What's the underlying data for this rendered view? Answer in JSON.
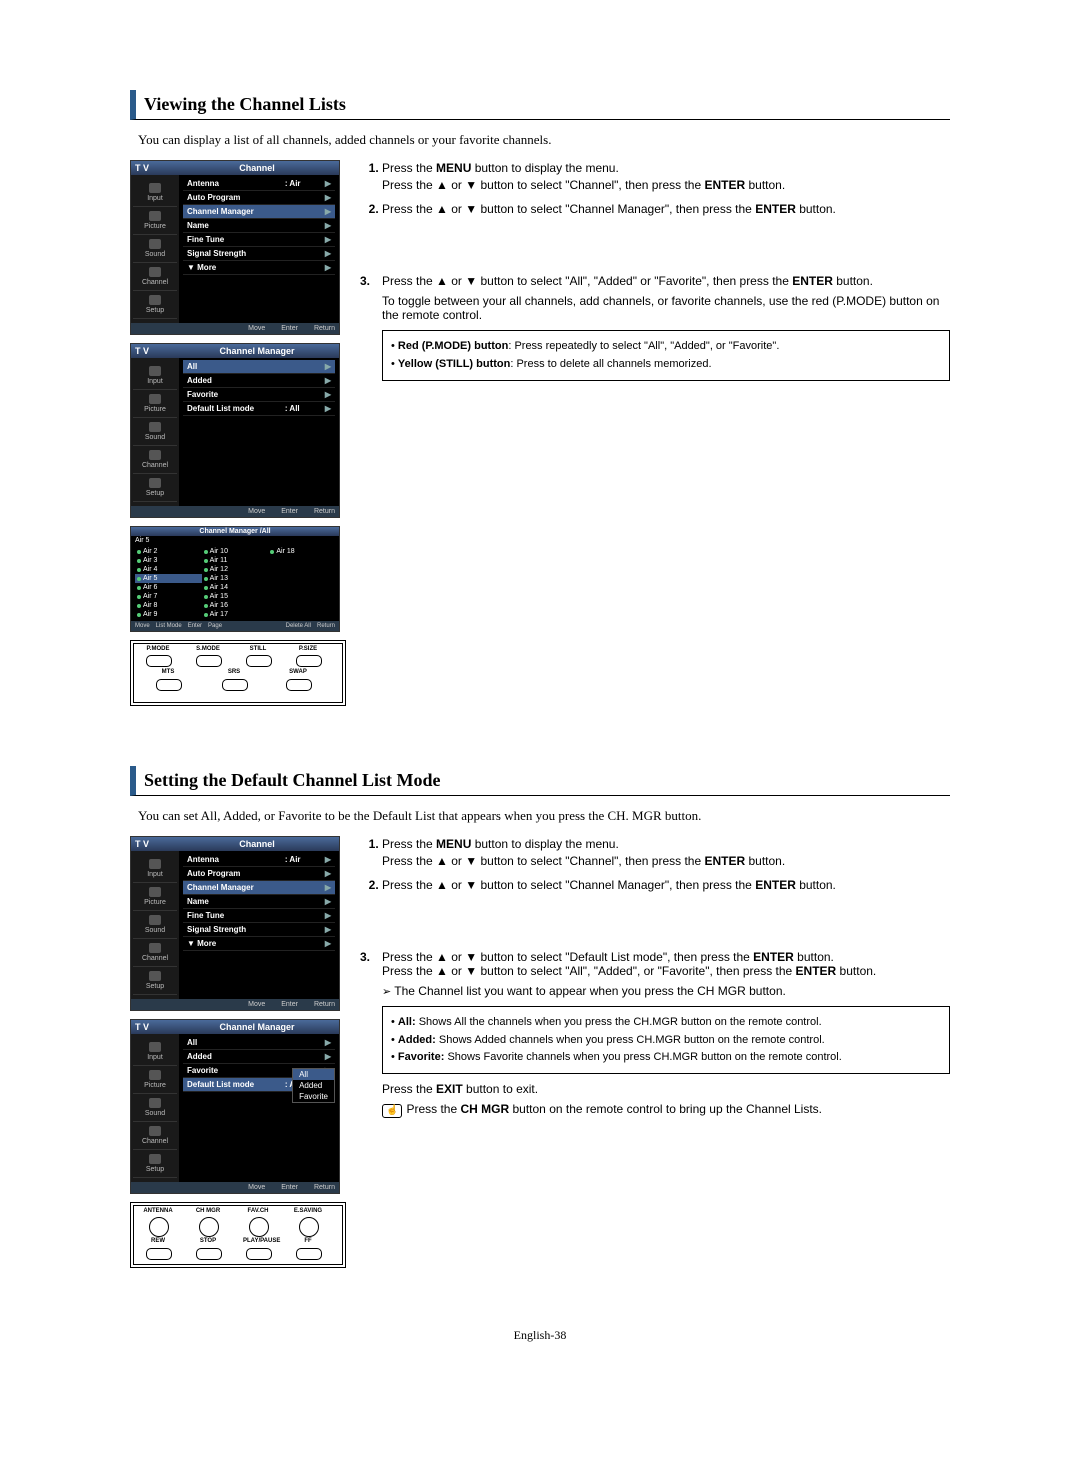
{
  "page_number": "English-38",
  "section1": {
    "heading": "Viewing the Channel Lists",
    "intro": "You can display a list of all channels, added channels or your favorite channels.",
    "osd1": {
      "tv": "T V",
      "title": "Channel",
      "sidebar": [
        "Input",
        "Picture",
        "Sound",
        "Channel",
        "Setup"
      ],
      "rows": [
        {
          "label": "Antenna",
          "value": ": Air",
          "hl": false
        },
        {
          "label": "Auto Program",
          "value": "",
          "hl": false
        },
        {
          "label": "Channel Manager",
          "value": "",
          "hl": true
        },
        {
          "label": "Name",
          "value": "",
          "hl": false
        },
        {
          "label": "Fine Tune",
          "value": "",
          "hl": false
        },
        {
          "label": "Signal Strength",
          "value": "",
          "hl": false
        },
        {
          "label": "▼ More",
          "value": "",
          "hl": false
        }
      ],
      "footer": [
        "Move",
        "Enter",
        "Return"
      ]
    },
    "osd2": {
      "tv": "T V",
      "title": "Channel Manager",
      "sidebar": [
        "Input",
        "Picture",
        "Sound",
        "Channel",
        "Setup"
      ],
      "rows": [
        {
          "label": "All",
          "value": "",
          "hl": true
        },
        {
          "label": "Added",
          "value": "",
          "hl": false
        },
        {
          "label": "Favorite",
          "value": "",
          "hl": false
        },
        {
          "label": "Default List mode",
          "value": ": All",
          "hl": false
        }
      ],
      "footer": [
        "Move",
        "Enter",
        "Return"
      ]
    },
    "chlist": {
      "title": "Channel Manager /All",
      "header": "Air 5",
      "col1": [
        "Air 2",
        "Air 3",
        "Air 4",
        "Air 5",
        "Air 6",
        "Air 7",
        "Air 8",
        "Air 9"
      ],
      "col2": [
        "Air 10",
        "Air 11",
        "Air 12",
        "Air 13",
        "Air 14",
        "Air 15",
        "Air 16",
        "Air 17"
      ],
      "col3": [
        "Air 18"
      ],
      "footer": [
        "Move",
        "List Mode",
        "Enter",
        "Page",
        "Delete All",
        "Return"
      ]
    },
    "remote": {
      "row1": [
        "P.MODE",
        "S.MODE",
        "STILL",
        "P.SIZE"
      ],
      "row2": [
        "MTS",
        "SRS",
        "SWAP"
      ]
    },
    "steps_a": [
      "Press the <b>MENU</b> button to display the menu.<br>Press the <span class='up'>▲</span> or <span class='up'>▼</span> button to select \"Channel\", then press the <b>ENTER</b> button.",
      "Press the <span class='up'>▲</span> or <span class='up'>▼</span> button to select \"Channel Manager\", then press the <b>ENTER</b> button."
    ],
    "steps_b_num": "3.",
    "steps_b_text": "Press the <span class='up'>▲</span> or <span class='up'>▼</span> button to select \"All\", \"Added\" or \"Favorite\", then press the <b>ENTER</b> button.",
    "steps_b_sub": "To toggle between your all channels, add channels, or favorite channels, use the red (P.MODE) button on the remote control.",
    "notebox": [
      "<b>Red (P.MODE) button</b>: Press repeatedly to select \"All\", \"Added\", or \"Favorite\".",
      "<b>Yellow (STILL) button</b>: Press to delete all channels memorized."
    ]
  },
  "section2": {
    "heading": "Setting the Default Channel List Mode",
    "intro": "You can set All, Added, or Favorite to be the Default List that appears when you press the CH. MGR button.",
    "osd1": {
      "tv": "T V",
      "title": "Channel",
      "sidebar": [
        "Input",
        "Picture",
        "Sound",
        "Channel",
        "Setup"
      ],
      "rows": [
        {
          "label": "Antenna",
          "value": ": Air",
          "hl": false
        },
        {
          "label": "Auto Program",
          "value": "",
          "hl": false
        },
        {
          "label": "Channel Manager",
          "value": "",
          "hl": true
        },
        {
          "label": "Name",
          "value": "",
          "hl": false
        },
        {
          "label": "Fine Tune",
          "value": "",
          "hl": false
        },
        {
          "label": "Signal Strength",
          "value": "",
          "hl": false
        },
        {
          "label": "▼ More",
          "value": "",
          "hl": false
        }
      ],
      "footer": [
        "Move",
        "Enter",
        "Return"
      ]
    },
    "osd2": {
      "tv": "T V",
      "title": "Channel Manager",
      "sidebar": [
        "Input",
        "Picture",
        "Sound",
        "Channel",
        "Setup"
      ],
      "rows": [
        {
          "label": "All",
          "value": "",
          "hl": false
        },
        {
          "label": "Added",
          "value": "",
          "hl": false
        },
        {
          "label": "Favorite",
          "value": "",
          "hl": false
        },
        {
          "label": "Default List mode",
          "value": ": All",
          "hl": true
        }
      ],
      "submenu": [
        "All",
        "Added",
        "Favorite"
      ],
      "footer": [
        "Move",
        "Enter",
        "Return"
      ]
    },
    "remote": {
      "row1": [
        "ANTENNA",
        "CH MGR",
        "FAV.CH",
        "E.SAVING"
      ],
      "row2": [
        "REW",
        "STOP",
        "PLAY/PAUSE",
        "FF"
      ]
    },
    "steps_a": [
      "Press the <b>MENU</b> button to display the menu.<br>Press the <span class='up'>▲</span> or <span class='up'>▼</span> button to select \"Channel\", then press the <b>ENTER</b> button.",
      "Press the <span class='up'>▲</span> or <span class='up'>▼</span> button to select \"Channel Manager\", then press the <b>ENTER</b> button."
    ],
    "steps_b_num": "3.",
    "steps_b_text": "Press the <span class='up'>▲</span> or <span class='up'>▼</span> button to select \"Default List mode\", then press the <b>ENTER</b> button.<br>Press the <span class='up'>▲</span> or <span class='up'>▼</span> button to select \"All\", \"Added\", or \"Favorite\", then press the <b>ENTER</b> button.",
    "arrow_tip": "The Channel list you want to appear when you press the CH MGR button.",
    "mini_bullets": [
      "<b>All:</b> Shows All the channels when you press the CH.MGR button on the remote control.",
      "<b>Added:</b> Shows Added channels when you press CH.MGR button on the remote control.",
      "<b>Favorite:</b> Shows Favorite channels when you press CH.MGR button on the remote control."
    ],
    "exit_text": "Press the <b>EXIT</b> button to exit.",
    "chmgr_text": "Press the <b>CH MGR</b> button on the remote control to bring up the Channel Lists."
  }
}
